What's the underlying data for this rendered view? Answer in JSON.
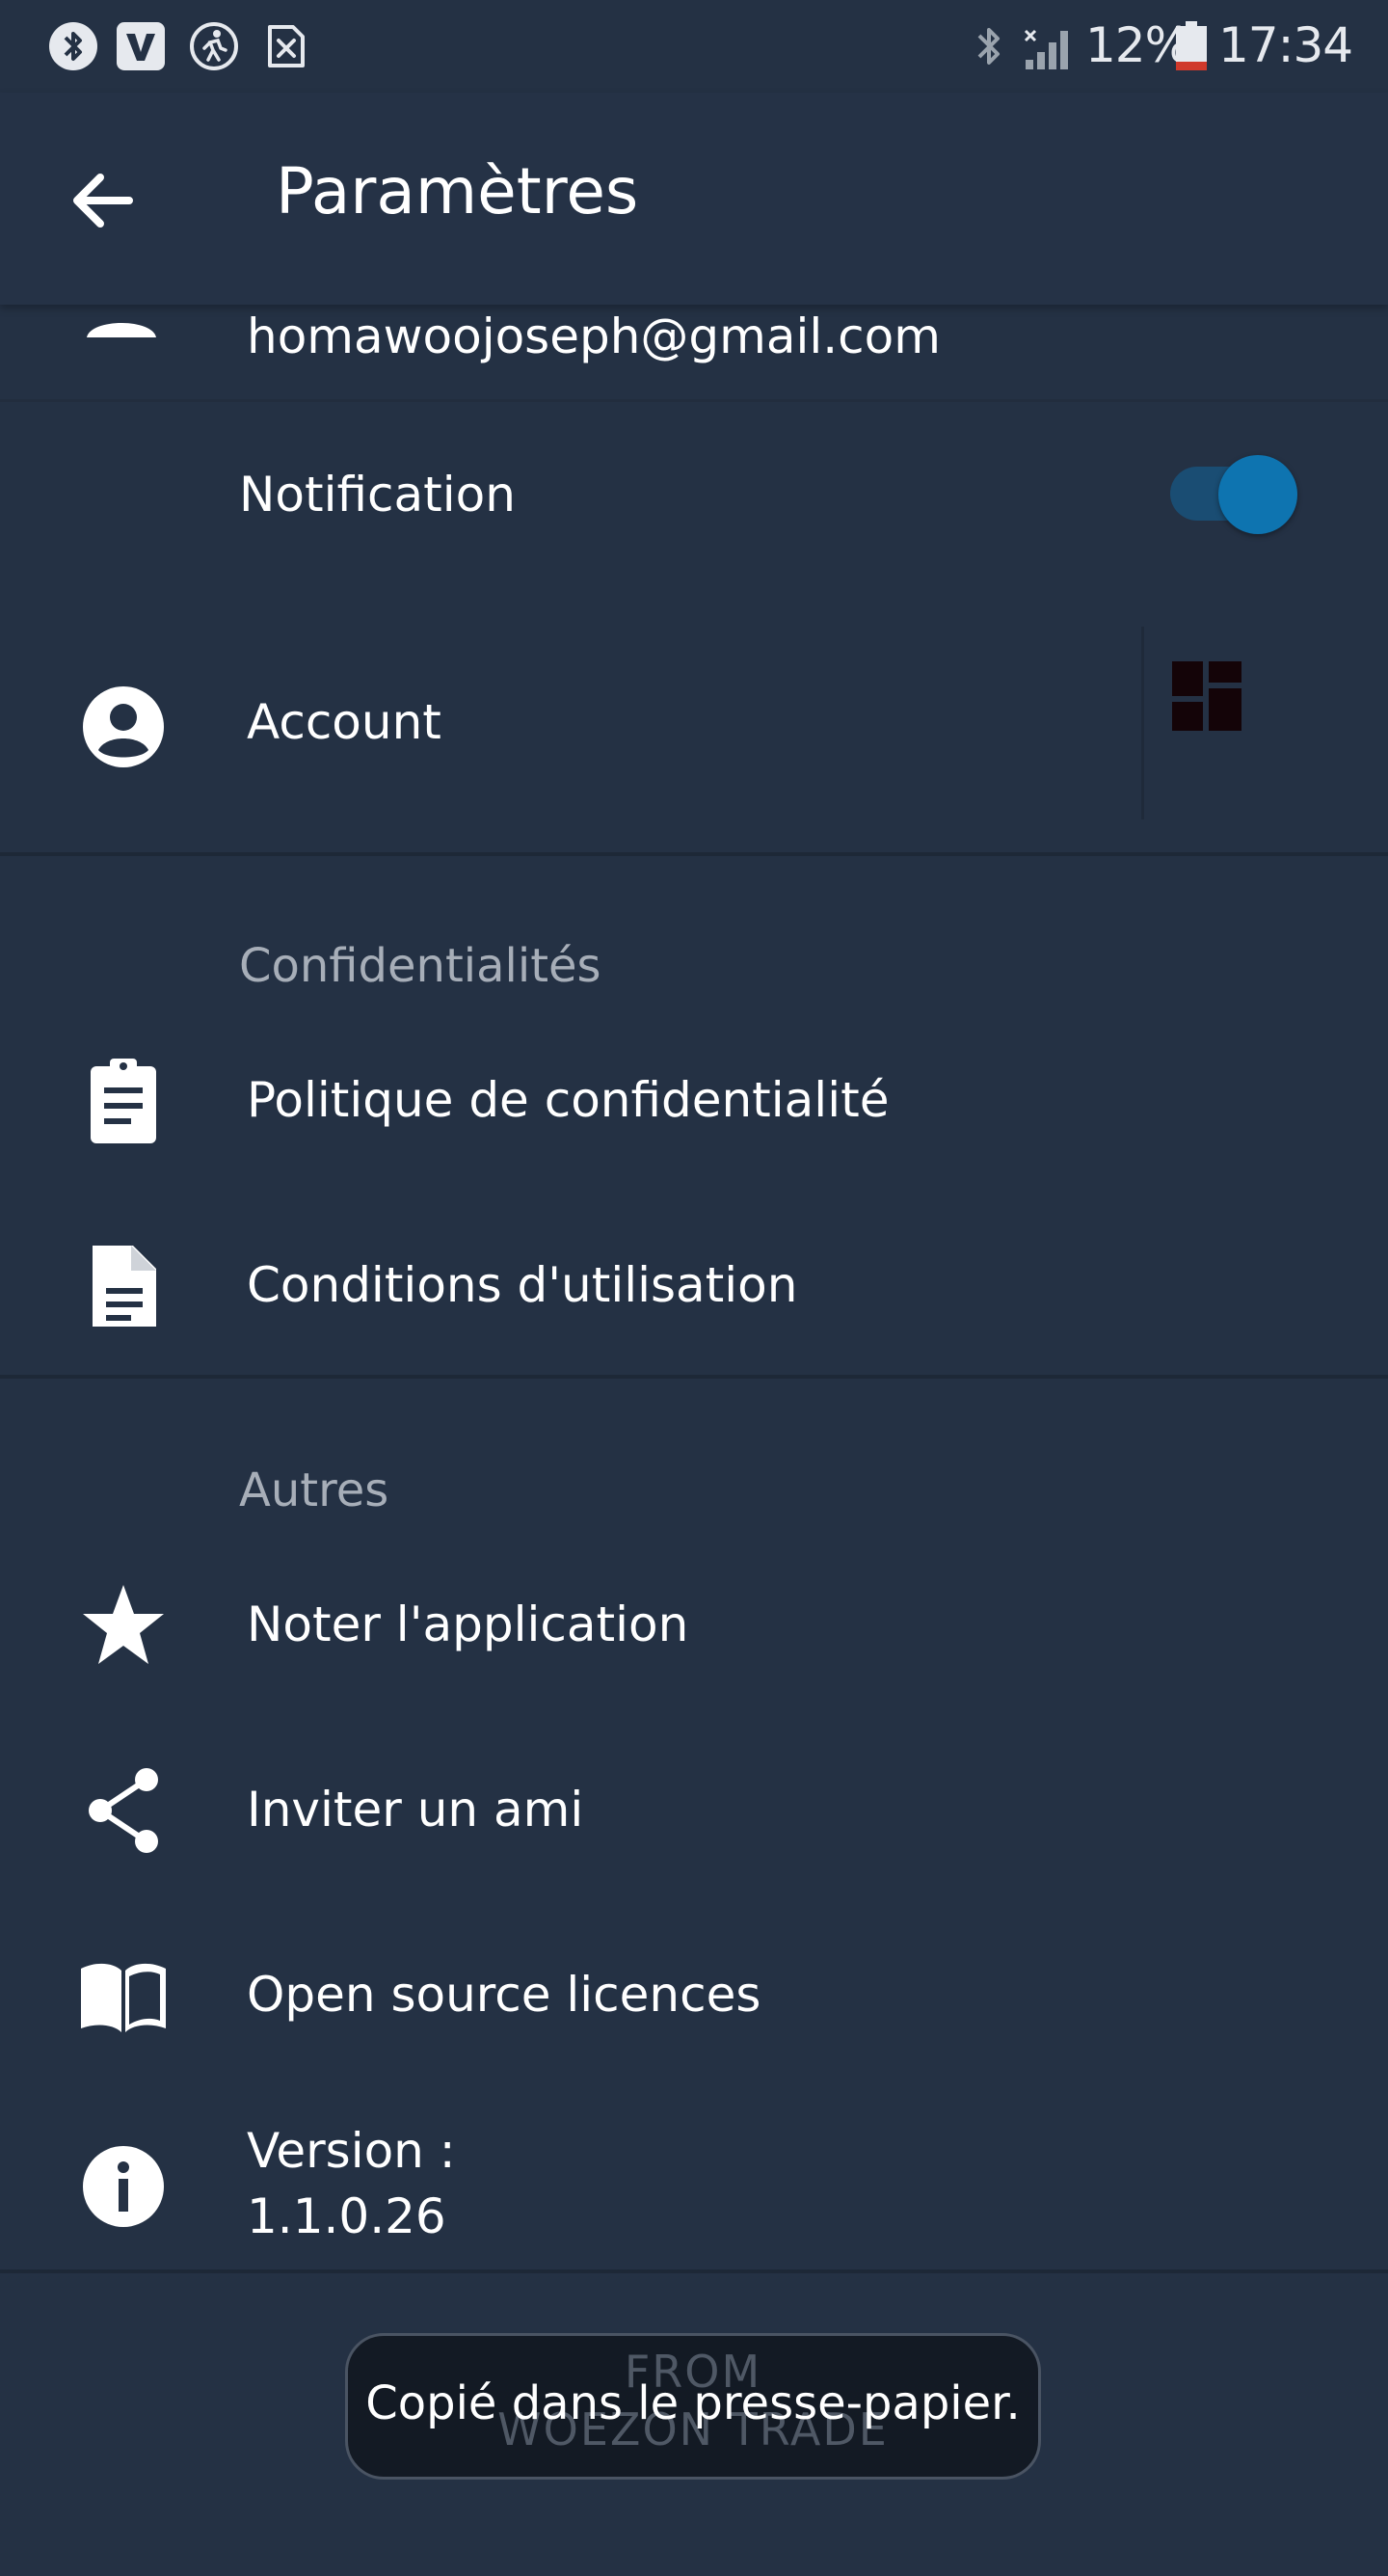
{
  "status_bar": {
    "battery_percent": "12%",
    "time": "17:34",
    "icons": [
      "bluetooth-icon",
      "vivo-app-icon",
      "activity-icon",
      "sim-error-icon",
      "bluetooth-icon",
      "signal-icon",
      "battery-icon"
    ]
  },
  "toolbar": {
    "title": "Paramètres",
    "back_icon": "arrow-back-icon"
  },
  "account_email": "homawoojoseph@gmail.com",
  "notification": {
    "label": "Notification",
    "enabled": true
  },
  "account": {
    "label": "Account",
    "icon": "account-circle-icon"
  },
  "sections": {
    "privacy": {
      "header": "Confidentialités",
      "items": [
        {
          "label": "Politique de confidentialité",
          "icon": "clipboard-icon"
        },
        {
          "label": "Conditions d'utilisation",
          "icon": "document-icon"
        }
      ]
    },
    "others": {
      "header": "Autres",
      "items": [
        {
          "label": "Noter l'application",
          "icon": "star-icon"
        },
        {
          "label": "Inviter un ami",
          "icon": "share-icon"
        },
        {
          "label": "Open source licences",
          "icon": "book-icon"
        }
      ],
      "version_label": "Version :",
      "version_value": "1.1.0.26"
    }
  },
  "toast": {
    "message": "Copié dans le presse-papier."
  },
  "watermark": {
    "line1": "FROM",
    "line2": "WOEZON TRADE"
  },
  "colors": {
    "background": "#243144",
    "toggle_accent": "#0e74b0",
    "section_header": "#a7aeb8"
  }
}
